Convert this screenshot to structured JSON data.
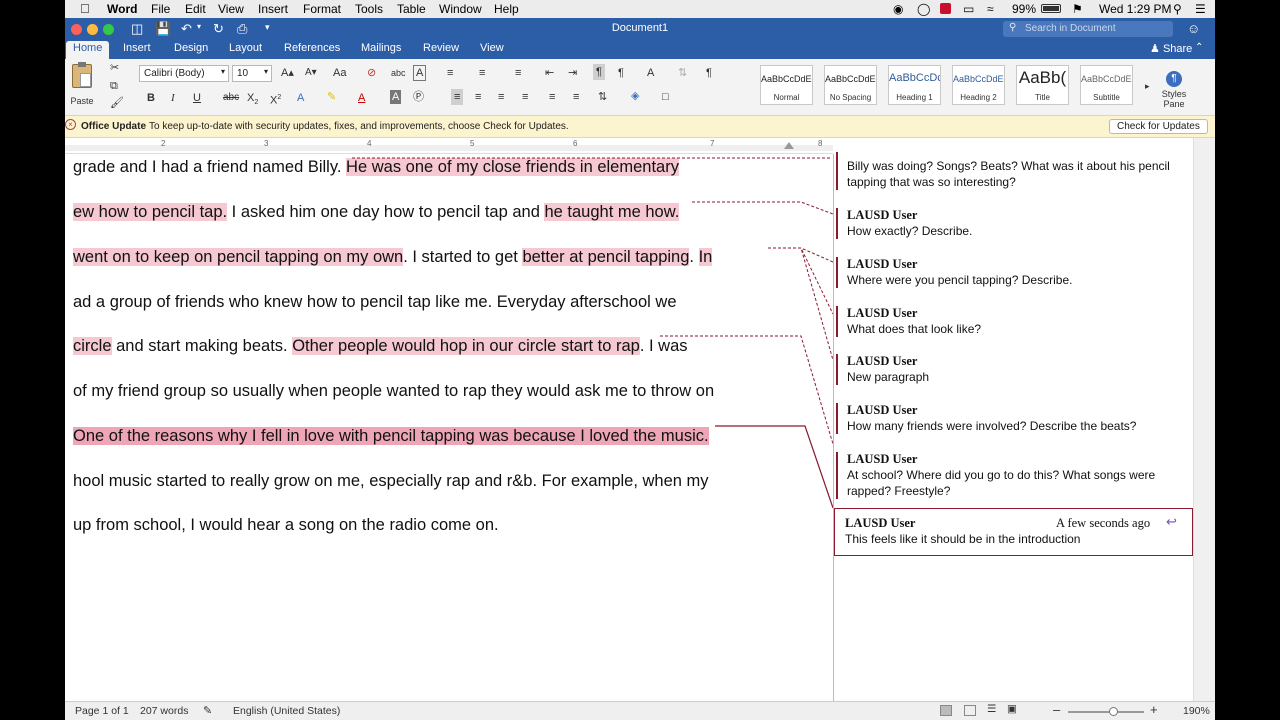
{
  "menubar": {
    "app": "Word",
    "items": [
      "File",
      "Edit",
      "View",
      "Insert",
      "Format",
      "Tools",
      "Table",
      "Window",
      "Help"
    ],
    "battery": "99%",
    "clock": "Wed 1:29 PM"
  },
  "window": {
    "title": "Document1",
    "search_placeholder": "Search in Document",
    "share_label": "Share"
  },
  "tabs": [
    "Home",
    "Insert",
    "Design",
    "Layout",
    "References",
    "Mailings",
    "Review",
    "View"
  ],
  "ribbon": {
    "paste_label": "Paste",
    "font_name": "Calibri (Body)",
    "font_size": "10",
    "styles": [
      {
        "sample": "AaBbCcDdEe",
        "name": "Normal"
      },
      {
        "sample": "AaBbCcDdEe",
        "name": "No Spacing"
      },
      {
        "sample": "AaBbCcDc",
        "name": "Heading 1"
      },
      {
        "sample": "AaBbCcDdEe",
        "name": "Heading 2"
      },
      {
        "sample": "AaBb(",
        "name": "Title"
      },
      {
        "sample": "AaBbCcDdEe",
        "name": "Subtitle"
      }
    ],
    "styles_pane_label": "Styles Pane"
  },
  "update_bar": {
    "title": "Office Update",
    "message": "To keep up-to-date with security updates, fixes, and improvements, choose Check for Updates.",
    "button": "Check for Updates"
  },
  "ruler": {
    "marks": [
      "2",
      "3",
      "4",
      "5",
      "6",
      "7",
      "8"
    ]
  },
  "document": {
    "lines": [
      {
        "segments": [
          {
            "text": " grade and I had a friend named Billy. "
          },
          {
            "text": "He was one of my close friends in elementary",
            "hl": "light"
          }
        ]
      },
      {
        "segments": [
          {
            "text": "ew how to pencil tap.",
            "hl": "light"
          },
          {
            "text": " I asked him one day how to pencil tap and "
          },
          {
            "text": "he taught me how.",
            "hl": "light"
          }
        ]
      },
      {
        "segments": [
          {
            "text": " went on to keep on pencil tapping on my own",
            "hl": "light"
          },
          {
            "text": ". I started to get "
          },
          {
            "text": "better at pencil tapping",
            "hl": "light"
          },
          {
            "text": ". "
          },
          {
            "text": "In",
            "hl": "light"
          }
        ]
      },
      {
        "segments": [
          {
            "text": "ad a group of friends who knew how to pencil tap like me. Everyday afterschool we"
          }
        ]
      },
      {
        "segments": [
          {
            "text": " circle",
            "hl": "light"
          },
          {
            "text": " and start making beats. "
          },
          {
            "text": "Other people would hop in our circle start to rap",
            "hl": "light"
          },
          {
            "text": ". I was"
          }
        ]
      },
      {
        "segments": [
          {
            "text": " of my friend group so usually when people wanted to rap they would ask me to throw on"
          }
        ]
      },
      {
        "segments": [
          {
            "text": "One of the reasons why I fell in love with pencil tapping was because I loved the music.",
            "hl": "strong"
          }
        ]
      },
      {
        "segments": [
          {
            "text": "hool music started to really grow on me, especially rap and r&b. For example, when my"
          }
        ]
      },
      {
        "segments": [
          {
            "text": "up from school, I would hear a song on the radio come on."
          }
        ]
      }
    ]
  },
  "comments": [
    {
      "author": "",
      "text": "Billy was doing? Songs? Beats? What was it about his pencil tapping that was so interesting?"
    },
    {
      "author": "LAUSD User",
      "text": "How exactly? Describe."
    },
    {
      "author": "LAUSD User",
      "text": "Where were you pencil tapping? Describe."
    },
    {
      "author": "LAUSD User",
      "text": "What does that look like?"
    },
    {
      "author": "LAUSD User",
      "text": "New paragraph"
    },
    {
      "author": "LAUSD User",
      "text": "How many friends were involved? Describe the beats?"
    },
    {
      "author": "LAUSD User",
      "text": "At school? Where did you go to do this? What songs were rapped? Freestyle?"
    },
    {
      "author": "LAUSD User",
      "text": "This feels like it should be in the introduction",
      "time": "A few seconds ago"
    }
  ],
  "status": {
    "page": "Page 1 of 1",
    "words": "207 words",
    "language": "English (United States)",
    "zoom": "190%"
  }
}
